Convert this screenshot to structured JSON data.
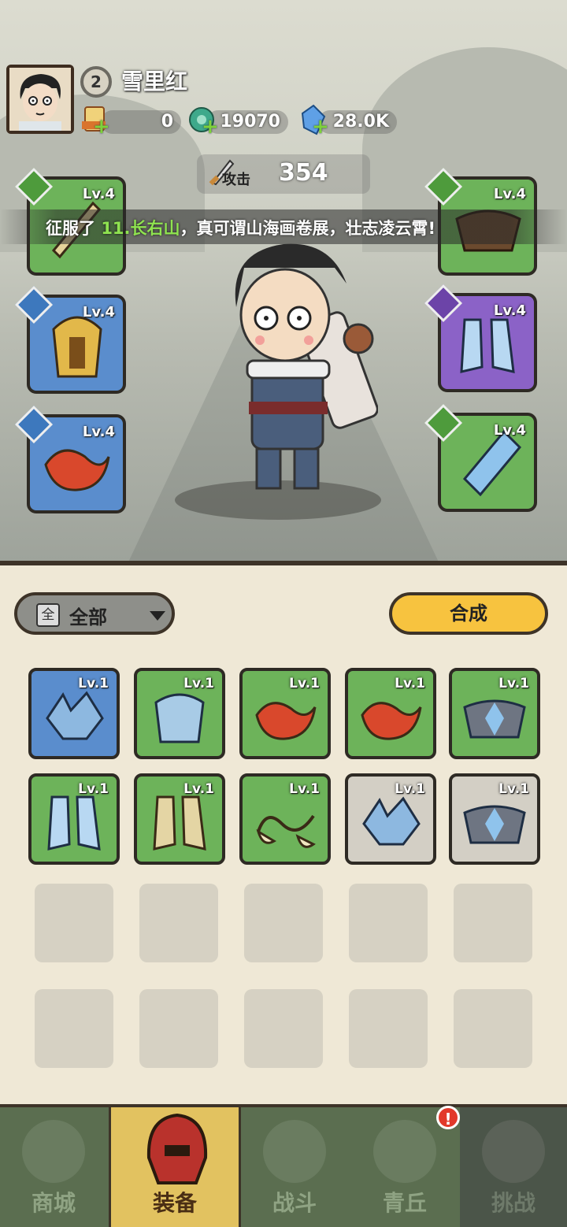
{
  "player": {
    "level": "2",
    "name": "雪里红"
  },
  "resources": [
    {
      "icon": "scroll-ticket-icon",
      "value": "0"
    },
    {
      "icon": "jade-dragon-icon",
      "value": "19070"
    },
    {
      "icon": "blue-crystal-icon",
      "value": "28.0K"
    }
  ],
  "attack": {
    "label": "攻击",
    "value": "354"
  },
  "banner": {
    "prefix": "征服了 ",
    "highlight": "11.长右山",
    "suffix": "，真可谓山海画卷展，壮志凌云霄!"
  },
  "equipped": {
    "left": [
      {
        "name": "weapon",
        "level": "Lv.4",
        "color": "green",
        "icon": "sword-icon"
      },
      {
        "name": "armor",
        "level": "Lv.4",
        "color": "blue",
        "icon": "golden-helmet-armor-icon"
      },
      {
        "name": "bracer",
        "level": "Lv.4",
        "color": "blue",
        "icon": "red-bracer-icon"
      }
    ],
    "right": [
      {
        "name": "belt",
        "level": "Lv.4",
        "color": "green",
        "icon": "belt-icon"
      },
      {
        "name": "boots",
        "level": "Lv.4",
        "color": "purple",
        "icon": "ice-boots-icon"
      },
      {
        "name": "accessory",
        "level": "Lv.4",
        "color": "green",
        "icon": "jade-pendant-icon"
      }
    ]
  },
  "filter": {
    "box": "全",
    "label": "全部"
  },
  "synthesize_label": "合成",
  "inventory": [
    {
      "level": "Lv.1",
      "color": "blue",
      "icon": "ice-bracer-icon"
    },
    {
      "level": "Lv.1",
      "color": "green",
      "icon": "ice-armor-icon"
    },
    {
      "level": "Lv.1",
      "color": "green",
      "icon": "red-bracer-icon"
    },
    {
      "level": "Lv.1",
      "color": "green",
      "icon": "red-bracer-icon"
    },
    {
      "level": "Lv.1",
      "color": "green",
      "icon": "ice-belt-icon"
    },
    {
      "level": "Lv.1",
      "color": "green",
      "icon": "ice-boots-icon"
    },
    {
      "level": "Lv.1",
      "color": "green",
      "icon": "bone-boots-icon"
    },
    {
      "level": "Lv.1",
      "color": "green",
      "icon": "claw-pendant-icon"
    },
    {
      "level": "Lv.1",
      "color": "grey",
      "icon": "ice-bracer-icon"
    },
    {
      "level": "Lv.1",
      "color": "grey",
      "icon": "ice-belt-icon"
    }
  ],
  "nav": [
    {
      "label": "商城",
      "icon": "shop-icon"
    },
    {
      "label": "装备",
      "icon": "helmet-icon"
    },
    {
      "label": "战斗",
      "icon": "crossed-swords-icon"
    },
    {
      "label": "青丘",
      "icon": "mountain-icon"
    },
    {
      "label": "挑战",
      "icon": "challenge-icon"
    }
  ],
  "nav_badge": "!",
  "colors": {
    "green": "#6db35a",
    "blue": "#5a8dcd",
    "purple": "#8b62c7",
    "grey": "#d3cfc5",
    "accent": "#f7c33f"
  }
}
